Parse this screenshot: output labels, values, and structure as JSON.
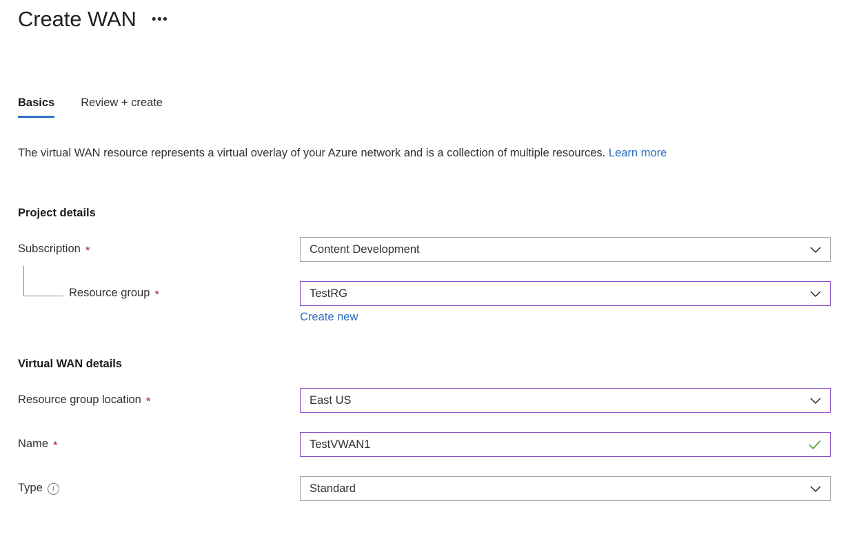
{
  "header": {
    "title": "Create WAN",
    "more_menu": "•••"
  },
  "tabs": [
    {
      "label": "Basics",
      "active": true
    },
    {
      "label": "Review + create",
      "active": false
    }
  ],
  "description": {
    "text": "The virtual WAN resource represents a virtual overlay of your Azure network and is a collection of multiple resources.",
    "link_label": "Learn more"
  },
  "sections": {
    "project_details": {
      "heading": "Project details",
      "fields": {
        "subscription": {
          "label": "Subscription",
          "required_marker": "*",
          "value": "Content Development",
          "control": "dropdown",
          "icon": "chevron-down-icon",
          "state": "default"
        },
        "resource_group": {
          "label": "Resource group",
          "required_marker": "*",
          "value": "TestRG",
          "control": "dropdown",
          "icon": "chevron-down-icon",
          "state": "focused",
          "create_new_label": "Create new"
        }
      }
    },
    "virtual_wan_details": {
      "heading": "Virtual WAN details",
      "fields": {
        "resource_group_location": {
          "label": "Resource group location",
          "required_marker": "*",
          "value": "East US",
          "control": "dropdown",
          "icon": "chevron-down-icon",
          "state": "focused"
        },
        "name": {
          "label": "Name",
          "required_marker": "*",
          "value": "TestVWAN1",
          "control": "textbox",
          "icon": "checkmark-icon",
          "state": "focused-valid"
        },
        "type": {
          "label": "Type",
          "info_marker": "i",
          "value": "Standard",
          "control": "dropdown",
          "icon": "chevron-down-icon",
          "state": "default"
        }
      }
    }
  },
  "colors": {
    "accent_blue": "#3072c4",
    "link_blue": "#2f6fbd",
    "focus_purple": "#8e4ec6",
    "required_red": "#a4262c",
    "valid_green": "#5da52e",
    "border_gray": "#a6a6a6",
    "text": "#323130"
  }
}
